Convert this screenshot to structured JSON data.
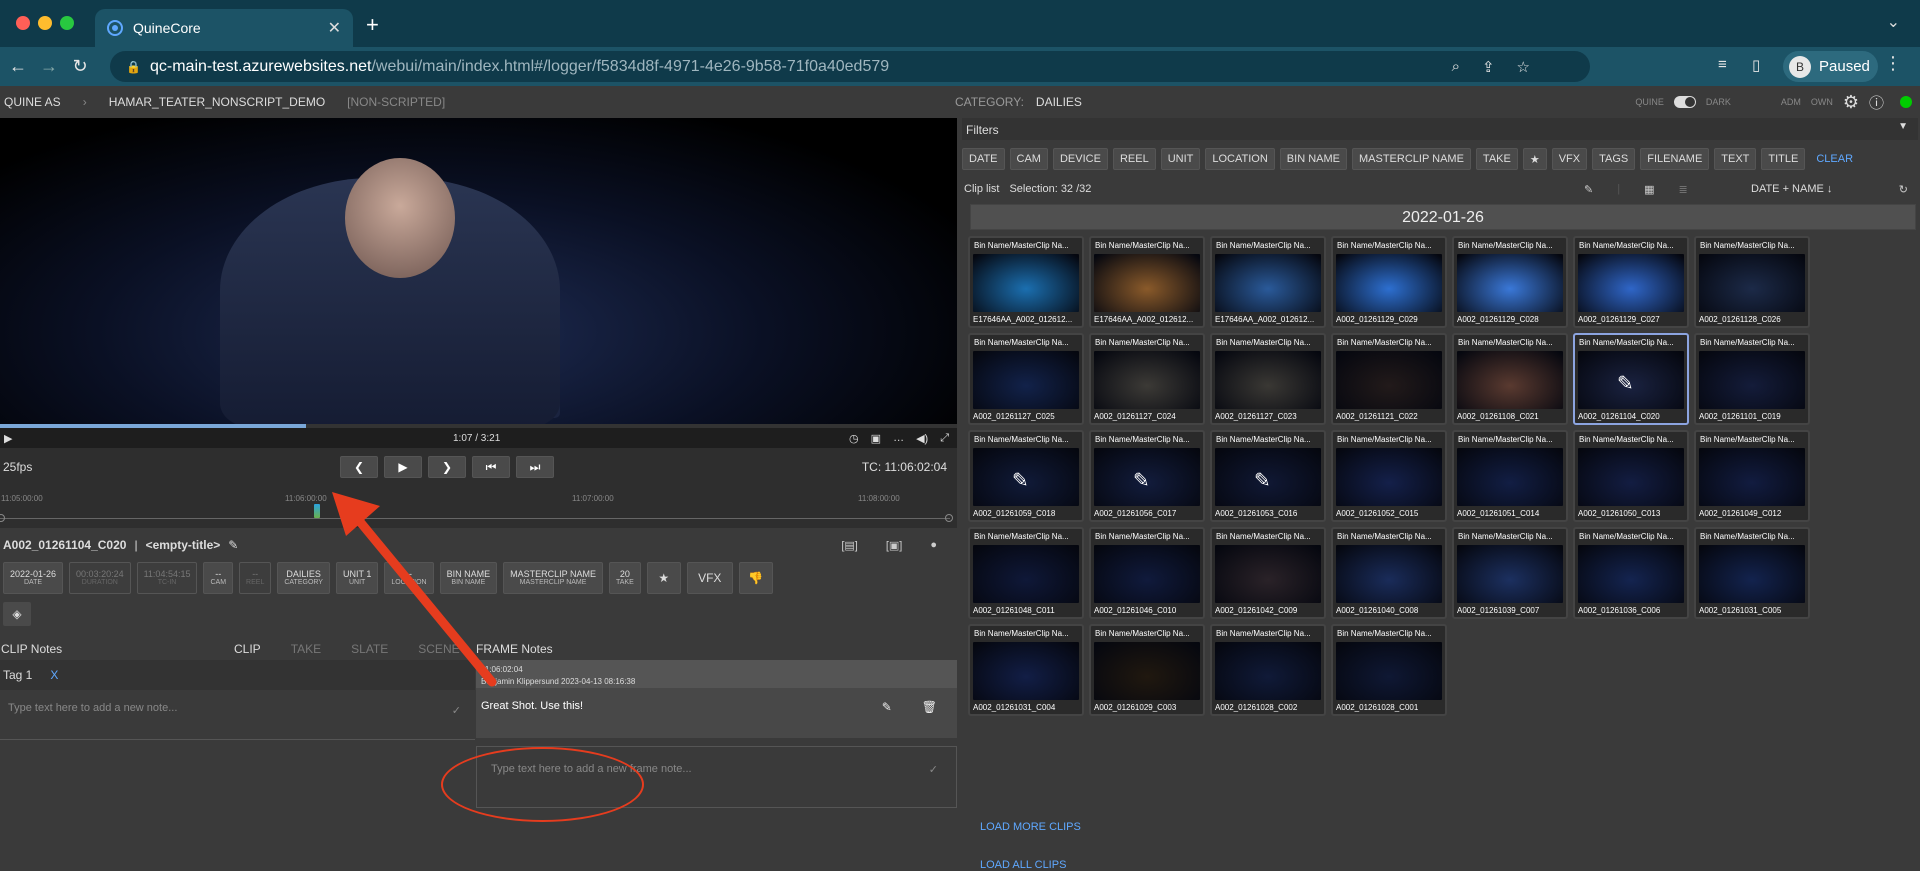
{
  "browser": {
    "tab_title": "QuineCore",
    "tab_close": "✕",
    "new_tab": "+",
    "url_host": "qc-main-test.azurewebsites.net",
    "url_path": "/webui/main/index.html#/logger/f5834d8f-4971-4e26-9b58-71f0a40ed579",
    "profile_initial": "B",
    "profile_label": "Paused"
  },
  "breadcrumb": {
    "org": "QUINE AS",
    "project": "HAMAR_TEATER_NONSCRIPT_DEMO",
    "mode": "[NON-SCRIPTED]"
  },
  "category": {
    "label": "CATEGORY:",
    "value": "DAILIES"
  },
  "theme": {
    "left": "QUINE",
    "right": "DARK",
    "adm": "ADM",
    "own": "OWN"
  },
  "player": {
    "time": "1:07 / 3:21",
    "progress": 0.32
  },
  "transport": {
    "fps": "25fps",
    "tc": "TC: 11:06:02:04",
    "buttons": [
      "❮",
      "▶",
      "❯",
      "⏮",
      "⏭"
    ],
    "ticks": [
      "11:05:00:00",
      "11:06:00:00",
      "11:07:00:00",
      "11:08:00:00"
    ]
  },
  "clip": {
    "name": "A002_01261104_C020",
    "sep": "|",
    "title": "<empty-title>"
  },
  "meta": [
    {
      "v": "2022-01-26",
      "l": "DATE",
      "dim": false
    },
    {
      "v": "00:03:20:24",
      "l": "DURATION",
      "dim": true
    },
    {
      "v": "11:04:54:15",
      "l": "TC-IN",
      "dim": true
    },
    {
      "v": "--",
      "l": "CAM",
      "dim": false
    },
    {
      "v": "--",
      "l": "REEL",
      "dim": true
    },
    {
      "v": "DAILIES",
      "l": "CATEGORY",
      "dim": false
    },
    {
      "v": "UNIT 1",
      "l": "UNIT",
      "dim": false
    },
    {
      "v": "--",
      "l": "LOCATION",
      "dim": false
    },
    {
      "v": "BIN NAME",
      "l": "BIN NAME",
      "dim": false
    },
    {
      "v": "MASTERCLIP NAME",
      "l": "MASTERCLIP NAME",
      "dim": false
    },
    {
      "v": "20",
      "l": "TAKE",
      "dim": false
    }
  ],
  "meta_extra": {
    "star": "★",
    "vfx": "VFX",
    "thumb": "👎"
  },
  "clip_notes": {
    "title": "CLIP Notes",
    "tabs": [
      "CLIP",
      "TAKE",
      "SLATE",
      "SCENE"
    ],
    "tag": "Tag 1",
    "tag_remove": "X",
    "placeholder": "Type text here to add a new note..."
  },
  "frame_notes": {
    "title": "FRAME Notes",
    "note_tc": "11:06:02:04",
    "note_author": "Benjamin Klippersund 2023-04-13 08:16:38",
    "note_text": "Great Shot. Use this!",
    "placeholder": "Type text here to add a new frame note..."
  },
  "filters": {
    "title": "Filters",
    "buttons": [
      "DATE",
      "CAM",
      "DEVICE",
      "REEL",
      "UNIT",
      "LOCATION",
      "BIN NAME",
      "MASTERCLIP NAME",
      "TAKE",
      "★",
      "VFX",
      "TAGS",
      "FILENAME",
      "TEXT",
      "TITLE"
    ],
    "clear": "CLEAR"
  },
  "cliplist": {
    "label": "Clip list",
    "selection": "Selection: 32 /32",
    "sort": "DATE + NAME",
    "sort_arrow": "↓",
    "date": "2022-01-26"
  },
  "clips": [
    {
      "top": "Bin Name/MasterClip Na...",
      "name": "E17646AA_A002_012612...",
      "c": "#1b6fb0",
      "sel": false,
      "pen": false
    },
    {
      "top": "Bin Name/MasterClip Na...",
      "name": "E17646AA_A002_012612...",
      "c": "#8a5a2a",
      "sel": false,
      "pen": false
    },
    {
      "top": "Bin Name/MasterClip Na...",
      "name": "E17646AA_A002_012612...",
      "c": "#2a5a9a",
      "sel": false,
      "pen": false
    },
    {
      "top": "Bin Name/MasterClip Na...",
      "name": "A002_01261129_C029",
      "c": "#2d6fd0",
      "sel": false,
      "pen": false
    },
    {
      "top": "Bin Name/MasterClip Na...",
      "name": "A002_01261129_C028",
      "c": "#3a78d8",
      "sel": false,
      "pen": false
    },
    {
      "top": "Bin Name/MasterClip Na...",
      "name": "A002_01261129_C027",
      "c": "#2f66c8",
      "sel": false,
      "pen": false
    },
    {
      "top": "Bin Name/MasterClip Na...",
      "name": "A002_01261128_C026",
      "c": "#1c2a48",
      "sel": false,
      "pen": false
    },
    {
      "top": "Bin Name/MasterClip Na...",
      "name": "A002_01261127_C025",
      "c": "#12224a",
      "sel": false,
      "pen": false
    },
    {
      "top": "Bin Name/MasterClip Na...",
      "name": "A002_01261127_C024",
      "c": "#3c3a36",
      "sel": false,
      "pen": false
    },
    {
      "top": "Bin Name/MasterClip Na...",
      "name": "A002_01261127_C023",
      "c": "#3a3834",
      "sel": false,
      "pen": false
    },
    {
      "top": "Bin Name/MasterClip Na...",
      "name": "A002_01261121_C022",
      "c": "#221a1a",
      "sel": false,
      "pen": false
    },
    {
      "top": "Bin Name/MasterClip Na...",
      "name": "A002_01261108_C021",
      "c": "#5a3a30",
      "sel": false,
      "pen": false
    },
    {
      "top": "Bin Name/MasterClip Na...",
      "name": "A002_01261104_C020",
      "c": "#1a2240",
      "sel": true,
      "pen": true
    },
    {
      "top": "Bin Name/MasterClip Na...",
      "name": "A002_01261101_C019",
      "c": "#141c3a",
      "sel": false,
      "pen": false
    },
    {
      "top": "Bin Name/MasterClip Na...",
      "name": "A002_01261059_C018",
      "c": "#101a38",
      "sel": false,
      "pen": true
    },
    {
      "top": "Bin Name/MasterClip Na...",
      "name": "A002_01261056_C017",
      "c": "#121c3c",
      "sel": false,
      "pen": true
    },
    {
      "top": "Bin Name/MasterClip Na...",
      "name": "A002_01261053_C016",
      "c": "#101834",
      "sel": false,
      "pen": true
    },
    {
      "top": "Bin Name/MasterClip Na...",
      "name": "A002_01261052_C015",
      "c": "#14204a",
      "sel": false,
      "pen": false
    },
    {
      "top": "Bin Name/MasterClip Na...",
      "name": "A002_01261051_C014",
      "c": "#121e44",
      "sel": false,
      "pen": false
    },
    {
      "top": "Bin Name/MasterClip Na...",
      "name": "A002_01261050_C013",
      "c": "#131d42",
      "sel": false,
      "pen": false
    },
    {
      "top": "Bin Name/MasterClip Na...",
      "name": "A002_01261049_C012",
      "c": "#121c40",
      "sel": false,
      "pen": false
    },
    {
      "top": "Bin Name/MasterClip Na...",
      "name": "A002_01261048_C011",
      "c": "#0f1838",
      "sel": false,
      "pen": false
    },
    {
      "top": "Bin Name/MasterClip Na...",
      "name": "A002_01261046_C010",
      "c": "#101a3c",
      "sel": false,
      "pen": false
    },
    {
      "top": "Bin Name/MasterClip Na...",
      "name": "A002_01261042_C009",
      "c": "#2a2228",
      "sel": false,
      "pen": false
    },
    {
      "top": "Bin Name/MasterClip Na...",
      "name": "A002_01261040_C008",
      "c": "#1a2c5a",
      "sel": false,
      "pen": false
    },
    {
      "top": "Bin Name/MasterClip Na...",
      "name": "A002_01261039_C007",
      "c": "#1c3060",
      "sel": false,
      "pen": false
    },
    {
      "top": "Bin Name/MasterClip Na...",
      "name": "A002_01261036_C006",
      "c": "#142450",
      "sel": false,
      "pen": false
    },
    {
      "top": "Bin Name/MasterClip Na...",
      "name": "A002_01261031_C005",
      "c": "#13234e",
      "sel": false,
      "pen": false
    },
    {
      "top": "Bin Name/MasterClip Na...",
      "name": "A002_01261031_C004",
      "c": "#121e46",
      "sel": false,
      "pen": false
    },
    {
      "top": "Bin Name/MasterClip Na...",
      "name": "A002_01261029_C003",
      "c": "#20180f",
      "sel": false,
      "pen": false
    },
    {
      "top": "Bin Name/MasterClip Na...",
      "name": "A002_01261028_C002",
      "c": "#101a38",
      "sel": false,
      "pen": false
    },
    {
      "top": "Bin Name/MasterClip Na...",
      "name": "A002_01261028_C001",
      "c": "#0f1834",
      "sel": false,
      "pen": false
    }
  ],
  "load_more": "LOAD MORE CLIPS",
  "load_all": "LOAD ALL CLIPS"
}
